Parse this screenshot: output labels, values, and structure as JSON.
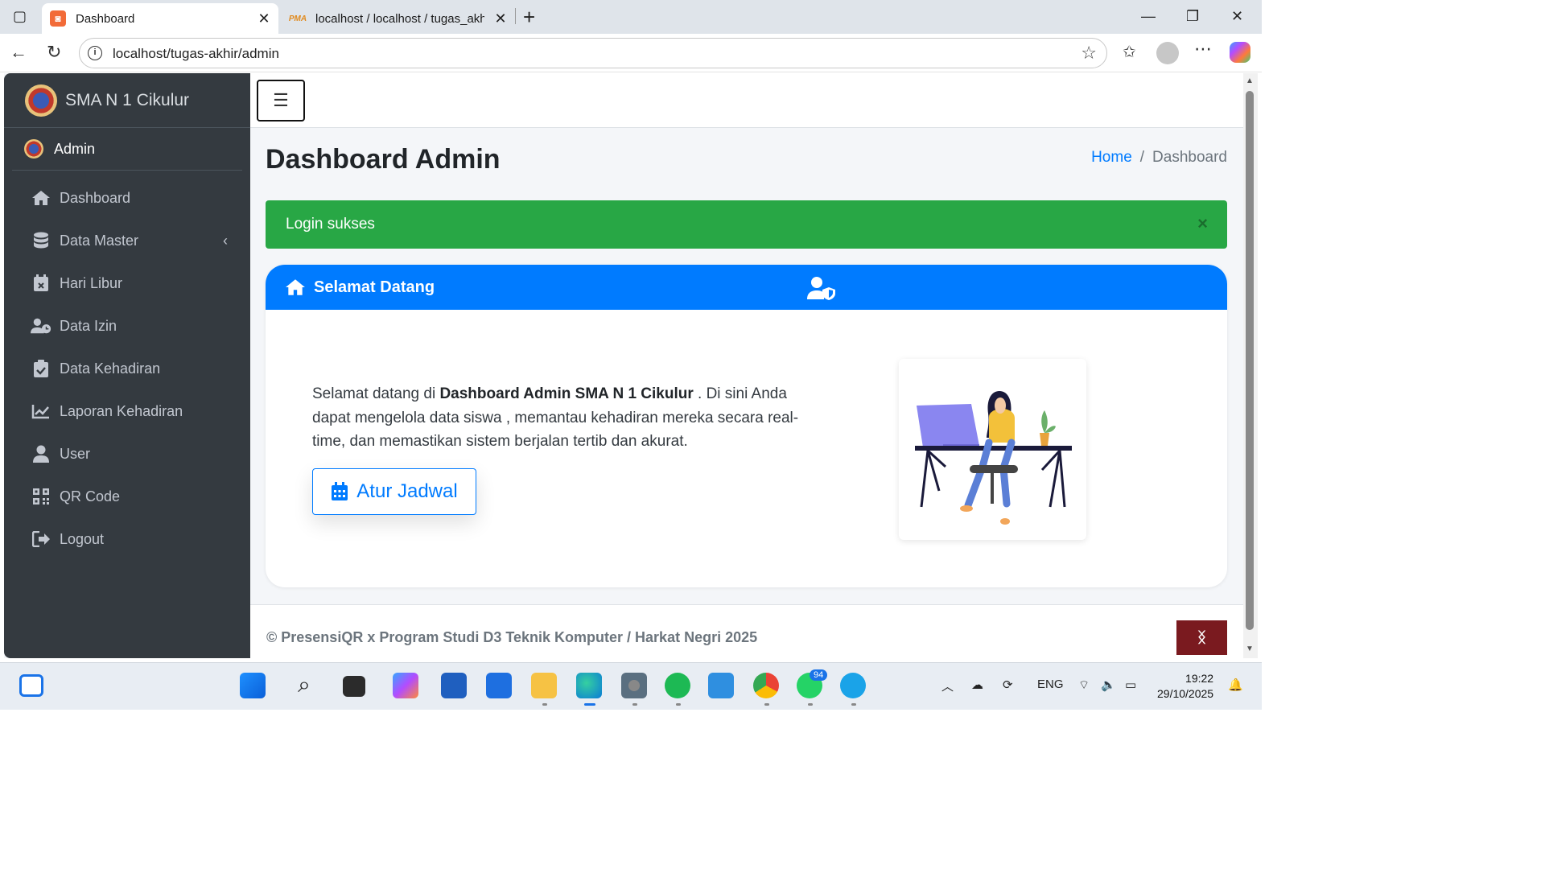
{
  "browser": {
    "tabs": [
      {
        "title": "Dashboard",
        "favicon": "dashboard-favicon"
      },
      {
        "title": "localhost / localhost / tugas_akhir",
        "favicon": "phpmyadmin-favicon"
      }
    ],
    "url": "localhost/tugas-akhir/admin"
  },
  "sidebar": {
    "brand": "SMA N 1 Cikulur",
    "user": "Admin",
    "items": [
      {
        "label": "Dashboard",
        "icon": "home-icon"
      },
      {
        "label": "Data Master",
        "icon": "database-icon"
      },
      {
        "label": "Hari Libur",
        "icon": "calendar-x-icon"
      },
      {
        "label": "Data Izin",
        "icon": "user-clock-icon"
      },
      {
        "label": "Data Kehadiran",
        "icon": "clipboard-check-icon"
      },
      {
        "label": "Laporan Kehadiran",
        "icon": "chart-line-icon"
      },
      {
        "label": "User",
        "icon": "user-icon"
      },
      {
        "label": "QR Code",
        "icon": "qrcode-icon"
      },
      {
        "label": "Logout",
        "icon": "logout-icon"
      }
    ]
  },
  "header": {
    "title": "Dashboard Admin",
    "breadcrumb": {
      "home": "Home",
      "separator": "/",
      "current": "Dashboard"
    }
  },
  "alert": {
    "text": "Login sukses",
    "close": "×",
    "color": "#28a745"
  },
  "card": {
    "title": "Selamat Datang",
    "welcome_prefix": "Selamat datang di ",
    "welcome_bold": "Dashboard Admin SMA N 1 Cikulur",
    "welcome_suffix": " . Di sini Anda dapat mengelola data siswa , memantau kehadiran mereka secara real-time, dan memastikan sistem berjalan tertib dan akurat.",
    "button": "Atur Jadwal",
    "accent": "#007bff"
  },
  "footer": {
    "text": "© PresensiQR x Program Studi D3 Teknik Komputer / Harkat Negri 2025"
  },
  "taskbar": {
    "language": "ENG",
    "time": "19:22",
    "date": "29/10/2025",
    "whatsapp_badge": "94"
  }
}
